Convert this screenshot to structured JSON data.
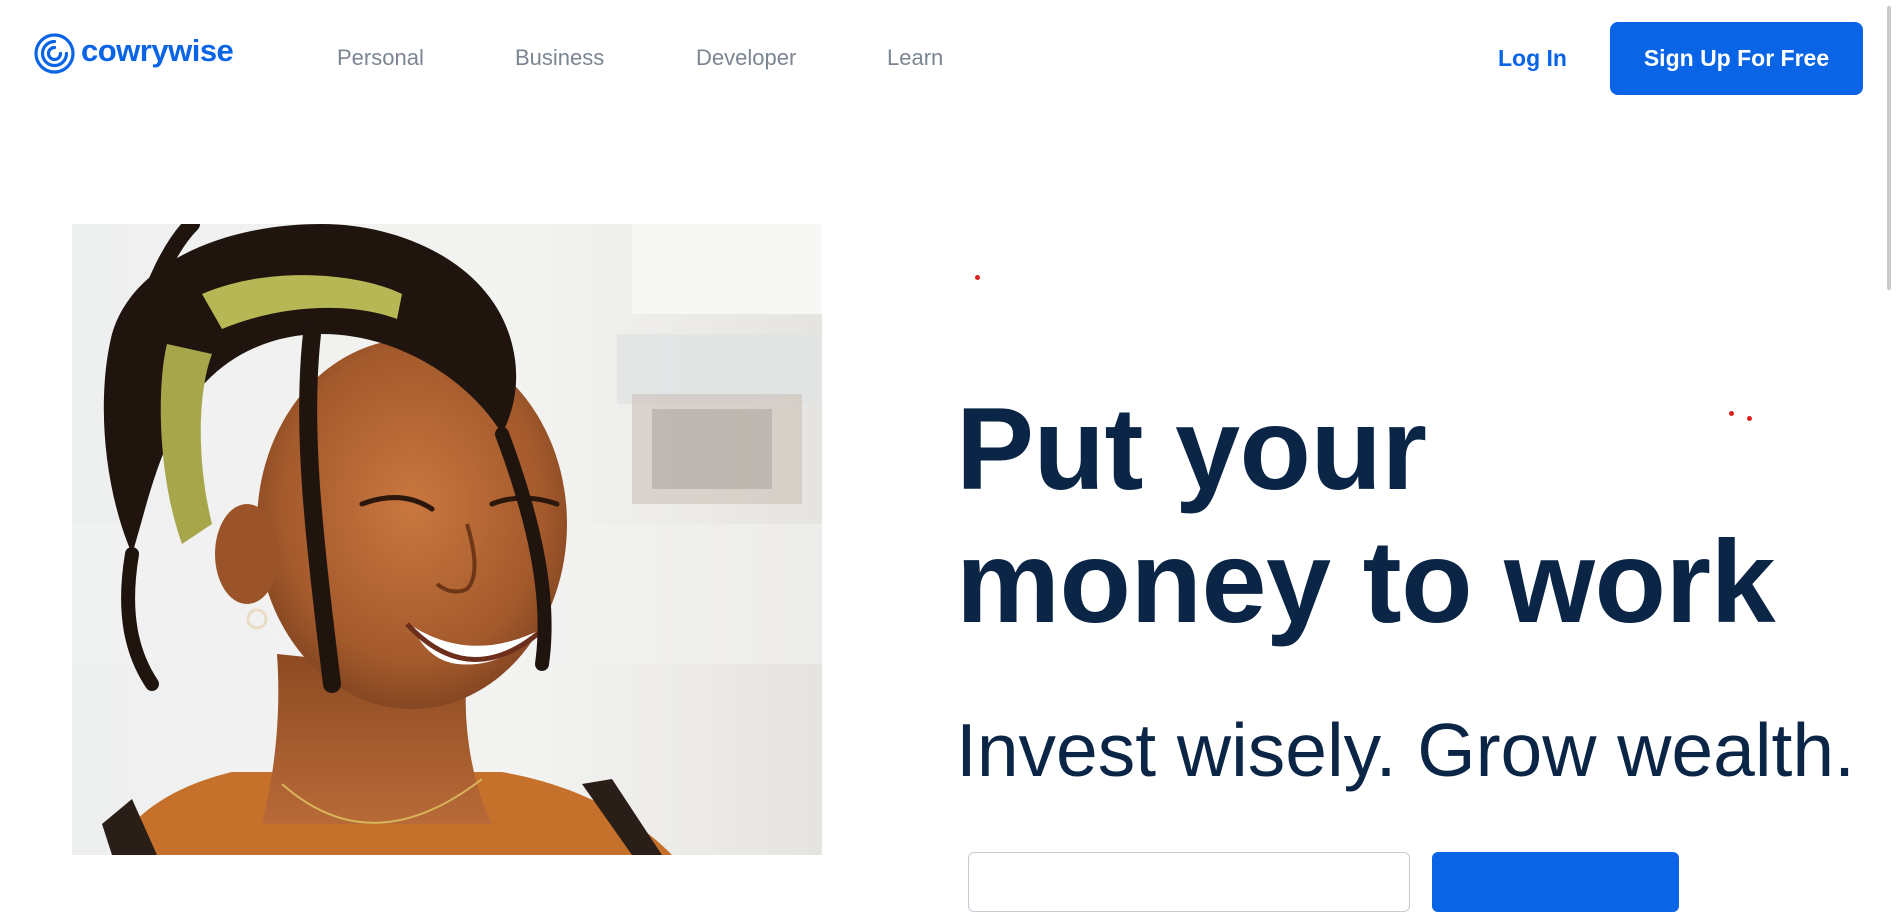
{
  "brand": {
    "name": "cowrywise",
    "color": "#0a64e6"
  },
  "nav": {
    "items": [
      {
        "label": "Personal"
      },
      {
        "label": "Business"
      },
      {
        "label": "Developer"
      },
      {
        "label": "Learn"
      }
    ]
  },
  "auth": {
    "login_label": "Log In",
    "signup_label": "Sign Up For Free"
  },
  "hero": {
    "headline_line1": "Put your",
    "headline_line2": "money to work",
    "subheadline": "Invest wisely. Grow wealth.",
    "image": "smiling woman with locs and headband",
    "text_color": "#0b2546"
  }
}
